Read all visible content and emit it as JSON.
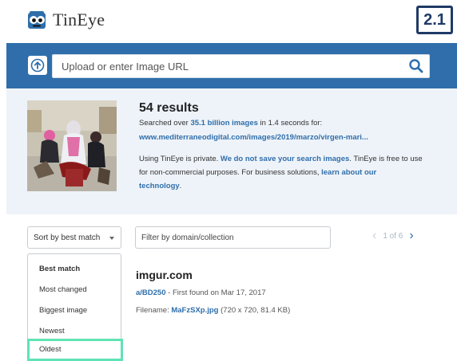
{
  "header": {
    "logo_text": "TinEye",
    "step_badge": "2.1"
  },
  "search": {
    "placeholder": "Upload or enter Image URL"
  },
  "results": {
    "count_title": "54 results",
    "searched_prefix": "Searched over ",
    "searched_count": "35.1 billion images",
    "searched_suffix": " in 1.4 seconds for:",
    "query_url": "www.mediterraneodigital.com/images/2019/marzo/virgen-mari...",
    "privacy_prefix": "Using TinEye is private. ",
    "privacy_link": "We do not save your search images",
    "privacy_suffix": ". TinEye is free to use",
    "privacy_line2": "for non-commercial purposes. For business solutions, ",
    "privacy_link2": "learn about our",
    "privacy_link3": "technology",
    "privacy_end": "."
  },
  "controls": {
    "sort_label": "Sort by best match",
    "filter_placeholder": "Filter by domain/collection",
    "pager_text": "1 of 6"
  },
  "sort_menu": {
    "options": [
      "Best match",
      "Most changed",
      "Biggest image",
      "Newest",
      "Oldest"
    ],
    "highlighted": "Oldest"
  },
  "match": {
    "domain": "imgur.com",
    "link": "a/BD250",
    "first_found": " - First found on Mar 17, 2017",
    "filename_label": "Filename: ",
    "filename": "MaFzSXp.jpg",
    "file_meta": " (720 x 720, 81.4 KB)"
  },
  "colors": {
    "brand_blue": "#2f6eaa",
    "panel_bg": "#eef3f9",
    "highlight_green": "#5fe3b4",
    "badge_navy": "#1f3a66"
  },
  "icons": {
    "upload": "upload-arrow-icon",
    "search": "search-icon",
    "prev": "chevron-left-icon",
    "next": "chevron-right-icon",
    "sort_caret": "caret-down-icon"
  }
}
